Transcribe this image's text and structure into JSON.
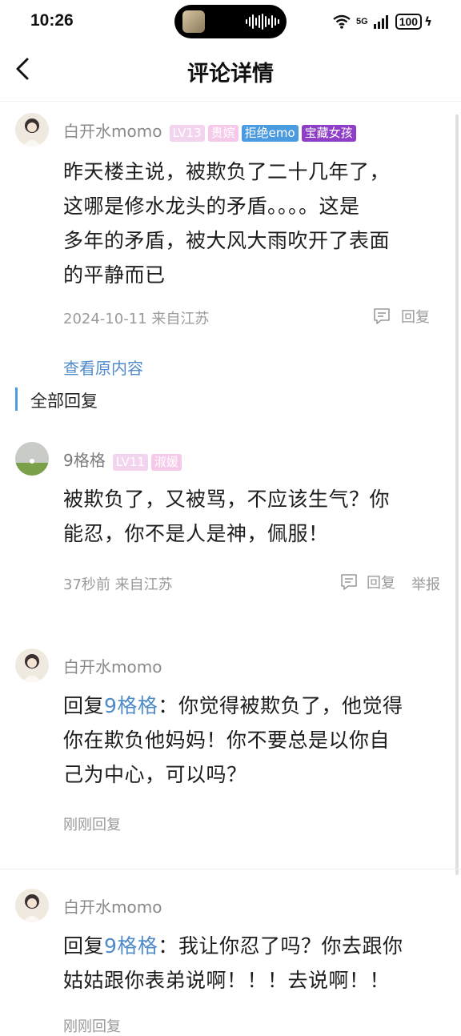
{
  "status": {
    "time": "10:26",
    "network": "5G",
    "battery": "100"
  },
  "nav": {
    "title": "评论详情"
  },
  "main_comment": {
    "username": "白开水momo",
    "badges": [
      {
        "text": "LV13",
        "bg": "#f2d4ef",
        "fg": "#ffffff"
      },
      {
        "text": "贵嫔",
        "bg": "#f5c9e9",
        "fg": "#ffffff"
      },
      {
        "text": "拒绝emo",
        "bg": "#4a9be0",
        "fg": "#ffffff"
      },
      {
        "text": "宝藏女孩",
        "bg": "#8f3fc7",
        "fg": "#ffffff"
      }
    ],
    "lines": [
      "昨天楼主说，被欺负了二十几年了，",
      "这哪是修水龙头的矛盾。。。。这是",
      "多年的矛盾，被大风大雨吹开了表面",
      "的平静而已"
    ],
    "meta": "2024-10-11 来自江苏",
    "reply_label": "回复",
    "view_original": "查看原内容"
  },
  "section": {
    "all_replies": "全部回复"
  },
  "replies": [
    {
      "username": "9格格",
      "badges": [
        {
          "text": "LV11",
          "bg": "#f2d4ef",
          "fg": "#ffffff"
        },
        {
          "text": "淑媛",
          "bg": "#f5c9e9",
          "fg": "#ffffff"
        }
      ],
      "lines": [
        "被欺负了，又被骂，不应该生气？你",
        "能忍，你不是人是神，佩服！"
      ],
      "meta": "37秒前 来自江苏",
      "reply_label": "回复",
      "report_label": "举报"
    },
    {
      "username": "白开水momo",
      "reply_prefix": "回复",
      "reply_to": "9格格",
      "colon": "：",
      "lines": [
        "你觉得被欺负了，他觉得",
        "你在欺负他妈妈！你不要总是以你自",
        "己为中心，可以吗？"
      ],
      "meta": "刚刚回复"
    },
    {
      "username": "白开水momo",
      "reply_prefix": "回复",
      "reply_to": "9格格",
      "colon": "：",
      "lines": [
        "我让你忍了吗？你去跟你",
        "姑姑跟你表弟说啊！！！去说啊！！"
      ],
      "meta": "刚刚回复"
    }
  ]
}
